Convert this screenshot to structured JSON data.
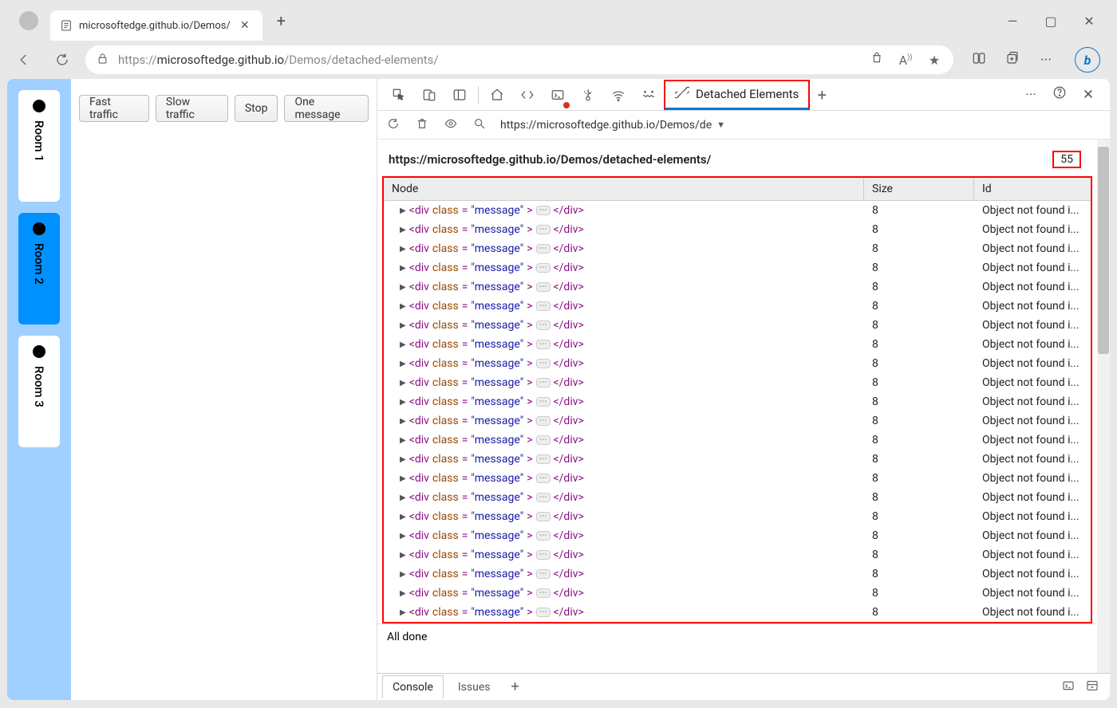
{
  "browser": {
    "tab_title": "microsoftedge.github.io/Demos/",
    "url_prefix": "https://",
    "url_domain": "microsoftedge.github.io",
    "url_path": "/Demos/detached-elements/"
  },
  "app": {
    "rooms": [
      {
        "label": "Room 1",
        "active": false
      },
      {
        "label": "Room 2",
        "active": true
      },
      {
        "label": "Room 3",
        "active": false
      }
    ],
    "buttons": [
      "Fast traffic",
      "Slow traffic",
      "Stop",
      "One message"
    ]
  },
  "devtools": {
    "active_tab": "Detached Elements",
    "toolbar_url": "https://microsoftedge.github.io/Demos/de",
    "breadcrumb": "https://microsoftedge.github.io/Demos/detached-elements/",
    "count_badge": "55",
    "columns": {
      "node": "Node",
      "size": "Size",
      "id": "Id"
    },
    "row_template": {
      "node_html": {
        "tag": "div",
        "attr_name": "class",
        "attr_val": "\"message\""
      },
      "size": "8",
      "id_text": "Object not found i..."
    },
    "row_count": 22,
    "status": "All done",
    "drawer": {
      "console": "Console",
      "issues": "Issues"
    }
  }
}
